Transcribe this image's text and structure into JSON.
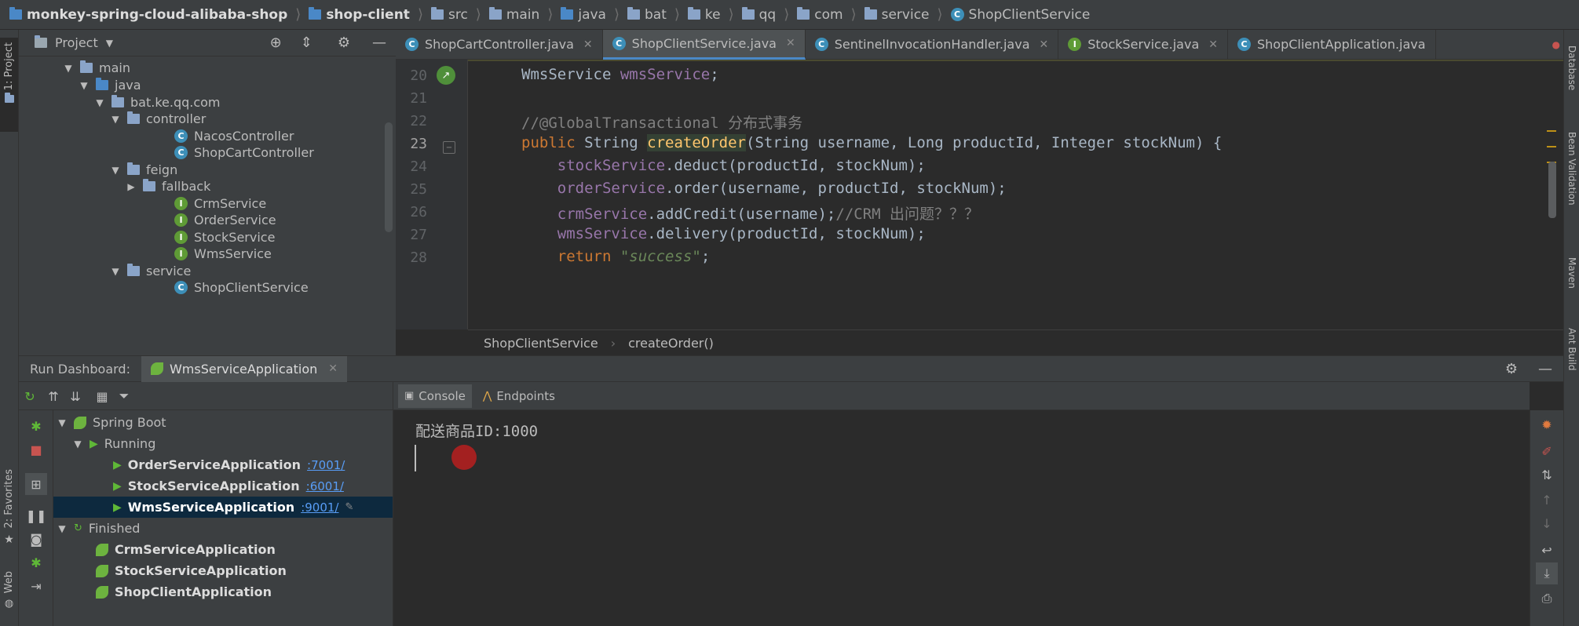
{
  "breadcrumb": {
    "items": [
      "monkey-spring-cloud-alibaba-shop",
      "shop-client",
      "src",
      "main",
      "java",
      "bat",
      "ke",
      "qq",
      "com",
      "service",
      "ShopClientService"
    ]
  },
  "left_strip": {
    "project_label": "1: Project",
    "favorites_label": "2: Favorites",
    "web_label": "Web"
  },
  "right_strip": {
    "labels": [
      "Database",
      "Bean Validation",
      "Maven",
      "Ant Build"
    ]
  },
  "project": {
    "title": "Project",
    "tree": [
      {
        "label": "main",
        "kind": "folder"
      },
      {
        "label": "java",
        "kind": "folder-blue"
      },
      {
        "label": "bat.ke.qq.com",
        "kind": "package"
      },
      {
        "label": "controller",
        "kind": "package"
      },
      {
        "label": "NacosController",
        "kind": "class"
      },
      {
        "label": "ShopCartController",
        "kind": "class"
      },
      {
        "label": "feign",
        "kind": "package"
      },
      {
        "label": "fallback",
        "kind": "package"
      },
      {
        "label": "CrmService",
        "kind": "interface"
      },
      {
        "label": "OrderService",
        "kind": "interface"
      },
      {
        "label": "StockService",
        "kind": "interface"
      },
      {
        "label": "WmsService",
        "kind": "interface"
      },
      {
        "label": "service",
        "kind": "package"
      },
      {
        "label": "ShopClientService",
        "kind": "class"
      }
    ]
  },
  "editor": {
    "tabs": [
      {
        "label": "ShopCartController.java",
        "icon": "class",
        "active": false
      },
      {
        "label": "ShopClientService.java",
        "icon": "class",
        "active": true
      },
      {
        "label": "SentinelInvocationHandler.java",
        "icon": "class",
        "active": false
      },
      {
        "label": "StockService.java",
        "icon": "interface",
        "active": false
      },
      {
        "label": "ShopClientApplication.java",
        "icon": "class",
        "active": false
      }
    ],
    "line_numbers": [
      "20",
      "21",
      "22",
      "23",
      "24",
      "25",
      "26",
      "27",
      "28"
    ],
    "breadcrumb": {
      "class": "ShopClientService",
      "method": "createOrder()"
    }
  },
  "run_dashboard": {
    "title": "Run Dashboard:",
    "config_tab": "WmsServiceApplication",
    "tree": {
      "root": "Spring Boot",
      "running_label": "Running",
      "running": [
        {
          "name": "OrderServiceApplication",
          "port": ":7001/"
        },
        {
          "name": "StockServiceApplication",
          "port": ":6001/"
        },
        {
          "name": "WmsServiceApplication",
          "port": ":9001/"
        }
      ],
      "finished_label": "Finished",
      "finished": [
        "CrmServiceApplication",
        "StockServiceApplication",
        "ShopClientApplication"
      ]
    },
    "console_tabs": [
      "Console",
      "Endpoints"
    ],
    "console_output": "配送商品ID:1000"
  },
  "colors": {
    "keyword": "#cc7832",
    "field": "#9876aa",
    "comment": "#808080",
    "string": "#6a8759",
    "method": "#ffc66d",
    "selection": "#0d293e"
  }
}
